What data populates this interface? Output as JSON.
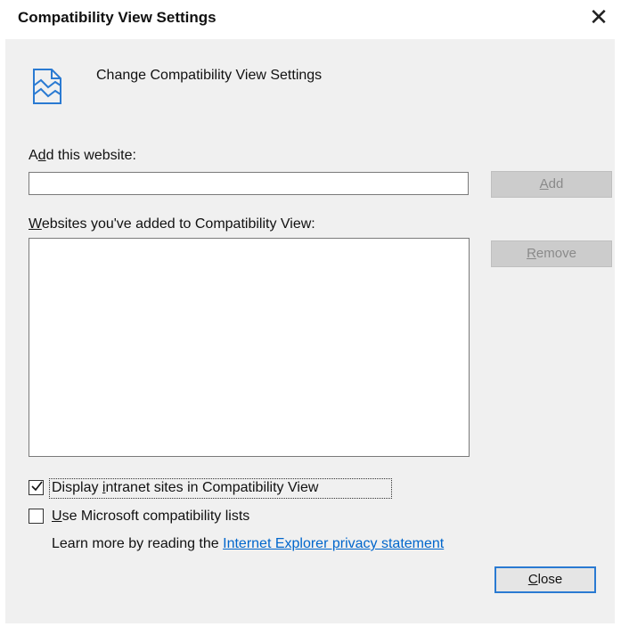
{
  "window": {
    "title": "Compatibility View Settings",
    "close_glyph": "✕"
  },
  "header": {
    "icon": "compatibility-page-icon",
    "text": "Change Compatibility View Settings"
  },
  "add_site": {
    "label_pre": "A",
    "label_u": "d",
    "label_post": "d this website:",
    "value": "",
    "button_pre": "",
    "button_u": "A",
    "button_post": "dd"
  },
  "list": {
    "label_u": "W",
    "label_post": "ebsites you've added to Compatibility View:",
    "items": [],
    "remove_pre": "",
    "remove_u": "R",
    "remove_post": "emove"
  },
  "options": {
    "intranet_pre": "Display ",
    "intranet_u": "i",
    "intranet_post": "ntranet sites in Compatibility View",
    "intranet_checked": true,
    "mslist_u": "U",
    "mslist_post": "se Microsoft compatibility lists",
    "mslist_checked": false
  },
  "learn_more": {
    "text": "Learn more by reading the ",
    "link": "Internet Explorer privacy statement"
  },
  "footer": {
    "close_u": "C",
    "close_post": "lose"
  },
  "colors": {
    "dialog_bg": "#f0f0f0",
    "disabled_button": "#cccccc",
    "link": "#0066cc",
    "focus_border": "#2a7ad2"
  }
}
